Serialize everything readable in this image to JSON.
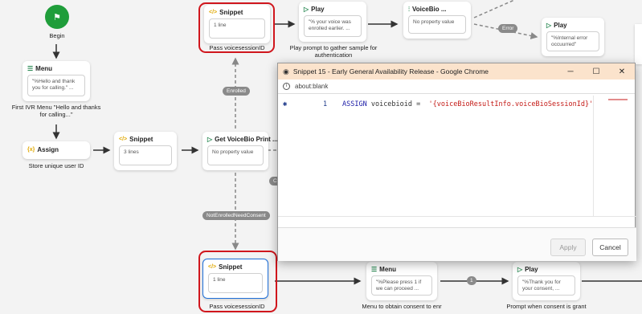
{
  "begin": {
    "label": "Begin"
  },
  "nodes": {
    "menu_first": {
      "title": "Menu",
      "body": "\"%Hello and thank you for calling.\" ...",
      "caption": "First IVR Menu \"Hello and thanks for calling...\""
    },
    "assign": {
      "title": "Assign",
      "caption": "Store unique user ID"
    },
    "snippet_mid": {
      "title": "Snippet",
      "body": "3 lines"
    },
    "get_voicebio": {
      "title": "Get VoiceBio Print ...",
      "body": "No property value"
    },
    "snippet_top": {
      "title": "Snippet",
      "body": "1 line",
      "caption": "Pass voicesessionID"
    },
    "play_top": {
      "title": "Play",
      "body": "\"% your voice was enrolled earlier. ...",
      "caption": "Play prompt to gather sample for authentication"
    },
    "voicebio_top": {
      "title": "VoiceBio ...",
      "body": "No property value"
    },
    "play_error": {
      "title": "Play",
      "body": "\"%Internal error occuurred\""
    },
    "snippet_bottom": {
      "title": "Snippet",
      "body": "1 line",
      "caption": "Pass voicesessionID"
    },
    "menu_bottom": {
      "title": "Menu",
      "body": "\"%Please press 1 if we can proceed ...",
      "caption": "Menu to obtain consent to enr"
    },
    "play_bottom": {
      "title": "Play",
      "body": "\"%Thank you for your consent, ...",
      "caption": "Prompt when consent is grant"
    }
  },
  "pills": {
    "enrolled": "Enrolled",
    "error": "Error",
    "not_enrolled": "NotEnrolledNeedConsent",
    "one": "1",
    "co": "Co"
  },
  "popup": {
    "title": "Snippet 15 - Early General Availability Release - Google Chrome",
    "address": "about:blank",
    "line_number": "1",
    "code_keyword": "ASSIGN",
    "code_var": " voicebioid = ",
    "code_string": "'{voiceBioResultInfo.voiceBioSessionId}'",
    "apply_label": "Apply",
    "cancel_label": "Cancel",
    "minimize": "─",
    "maximize": "☐",
    "close": "✕"
  }
}
